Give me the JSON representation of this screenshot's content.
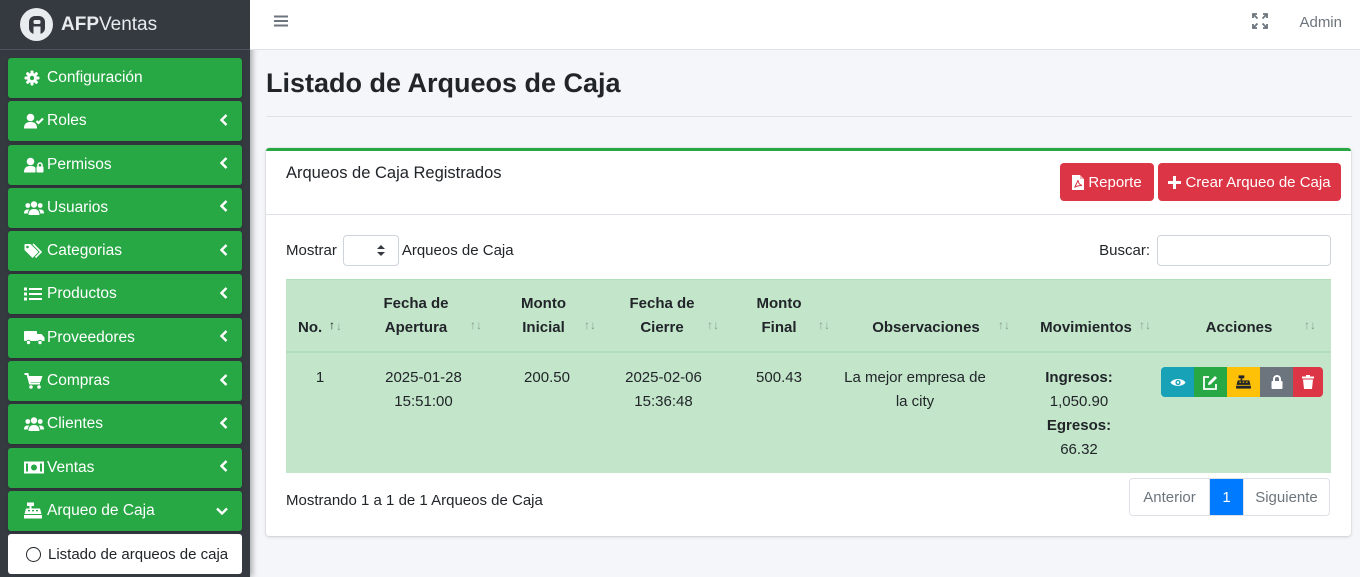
{
  "brand": {
    "bold": "AFP",
    "rest": "Ventas"
  },
  "sidebar": {
    "items": [
      {
        "label": "Configuración",
        "icon": "gear-icon"
      },
      {
        "label": "Roles",
        "icon": "user-check-icon"
      },
      {
        "label": "Permisos",
        "icon": "user-lock-icon"
      },
      {
        "label": "Usuarios",
        "icon": "users-icon"
      },
      {
        "label": "Categorias",
        "icon": "tags-icon"
      },
      {
        "label": "Productos",
        "icon": "list-icon"
      },
      {
        "label": "Proveedores",
        "icon": "truck-icon"
      },
      {
        "label": "Compras",
        "icon": "cart-icon"
      },
      {
        "label": "Clientes",
        "icon": "users-icon"
      },
      {
        "label": "Ventas",
        "icon": "money-icon"
      },
      {
        "label": "Arqueo de Caja",
        "icon": "cash-register-icon"
      }
    ],
    "sub_item": "Listado de arqueos de caja"
  },
  "topbar": {
    "user": "Admin"
  },
  "page": {
    "title": "Listado de Arqueos de Caja"
  },
  "card": {
    "title": "Arqueos de Caja Registrados",
    "report_label": "Reporte",
    "create_label": "Crear Arqueo de Caja"
  },
  "controls": {
    "show_prefix": "Mostrar",
    "show_suffix": "Arqueos de Caja",
    "search_label": "Buscar:"
  },
  "table": {
    "headers": {
      "no": "No.",
      "fa1": "Fecha de",
      "fa2": "Apertura",
      "mi1": "Monto",
      "mi2": "Inicial",
      "fc1": "Fecha de",
      "fc2": "Cierre",
      "mf1": "Monto",
      "mf2": "Final",
      "obs": "Observaciones",
      "mov": "Movimientos",
      "acc": "Acciones"
    },
    "rows": [
      {
        "no": "1",
        "fa_date": "2025-01-28",
        "fa_time": "15:51:00",
        "monto_inicial": "200.50",
        "fc_date": "2025-02-06",
        "fc_time": "15:36:48",
        "monto_final": "500.43",
        "obs1": "La mejor empresa de",
        "obs2": "la city",
        "ingresos_label": "Ingresos:",
        "ingresos": "1,050.90",
        "egresos_label": "Egresos:",
        "egresos": "66.32"
      }
    ]
  },
  "footer": {
    "info": "Mostrando 1 a 1 de 1 Arqueos de Caja",
    "prev": "Anterior",
    "page": "1",
    "next": "Siguiente"
  },
  "colors": {
    "sidebar_bg": "#343a40",
    "nav_green": "#28a745",
    "danger": "#dc3545",
    "table_row": "#c3e6cb",
    "primary": "#007bff"
  }
}
